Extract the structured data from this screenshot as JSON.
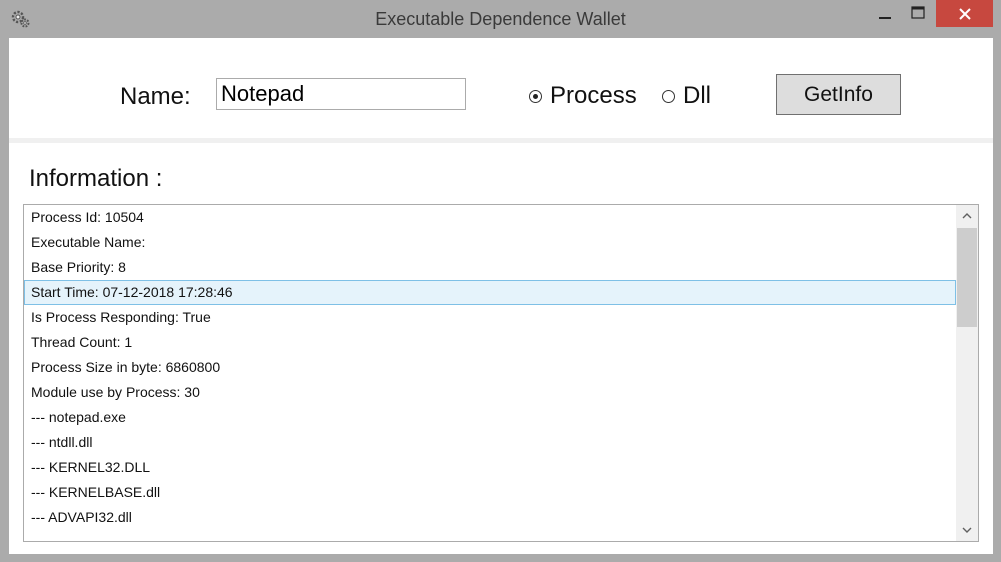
{
  "window": {
    "title": "Executable Dependence Wallet",
    "app_icon": "gear-icon",
    "controls": {
      "minimize": "minimize-icon",
      "maximize": "maximize-icon",
      "close": "close-icon"
    },
    "close_color": "#c7483f"
  },
  "form": {
    "name_label": "Name:",
    "name_value": "Notepad",
    "radio_process_label": "Process",
    "radio_dll_label": "Dll",
    "selected_radio": "Process",
    "getinfo_label": "GetInfo"
  },
  "info": {
    "heading": "Information :",
    "selected_index": 3,
    "items": [
      "Process Id: 10504",
      "Executable Name:",
      "Base Priority: 8",
      "Start Time: 07-12-2018 17:28:46",
      "Is Process Responding: True",
      "Thread Count: 1",
      "Process Size in byte: 6860800",
      "Module use by Process: 30",
      "--- notepad.exe",
      "--- ntdll.dll",
      "--- KERNEL32.DLL",
      "--- KERNELBASE.dll",
      "--- ADVAPI32.dll"
    ]
  }
}
